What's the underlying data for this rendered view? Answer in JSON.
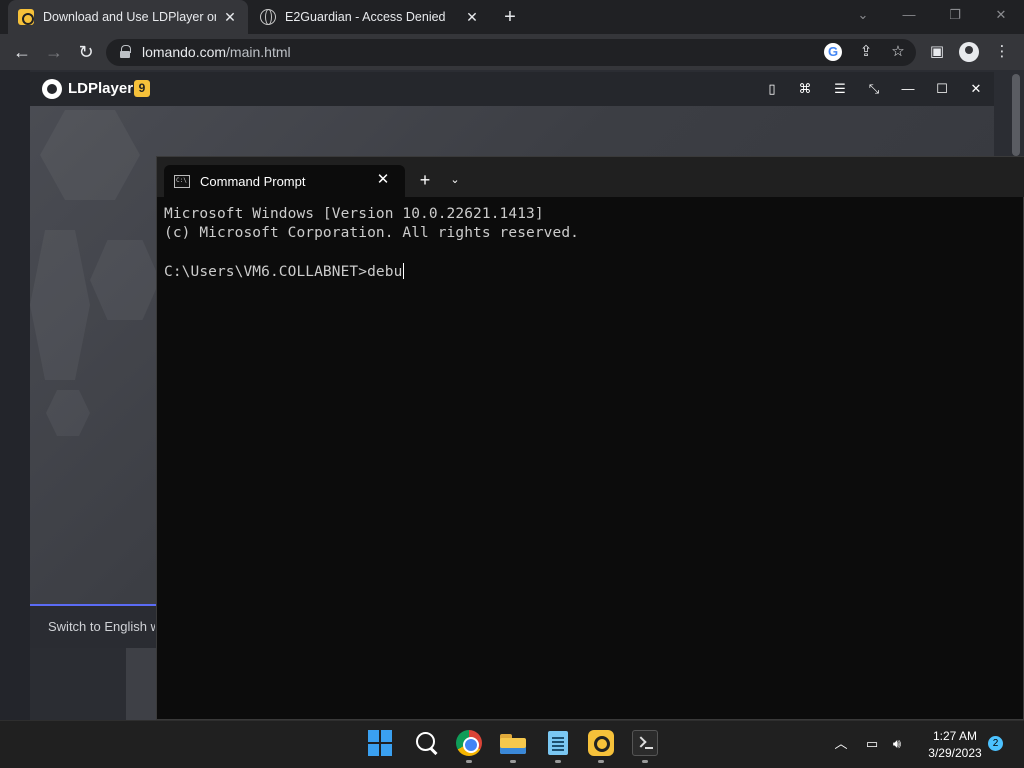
{
  "browser": {
    "tabs": [
      {
        "title": "Download and Use LDPlayer on P",
        "icon": "ldplayer-favicon",
        "active": true
      },
      {
        "title": "E2Guardian - Access Denied",
        "icon": "globe-favicon",
        "active": false
      }
    ],
    "url_host": "lomando.com",
    "url_path": "/main.html",
    "new_tab": "+"
  },
  "ldplayer": {
    "name": "LDPlayer",
    "badge": "9",
    "footer_text": "Switch to English w"
  },
  "terminal": {
    "tab_title": "Command Prompt",
    "lines": [
      "Microsoft Windows [Version 10.0.22621.1413]",
      "(c) Microsoft Corporation. All rights reserved.",
      "",
      "C:\\Users\\VM6.COLLABNET>debu"
    ]
  },
  "taskbar": {
    "time": "1:27 AM",
    "date": "3/29/2023",
    "notification_count": "2"
  },
  "colors": {
    "terminal_bg": "#0c0c0c",
    "chrome_toolbar": "#35363a",
    "ldplayer_accent": "#f6c13a"
  }
}
